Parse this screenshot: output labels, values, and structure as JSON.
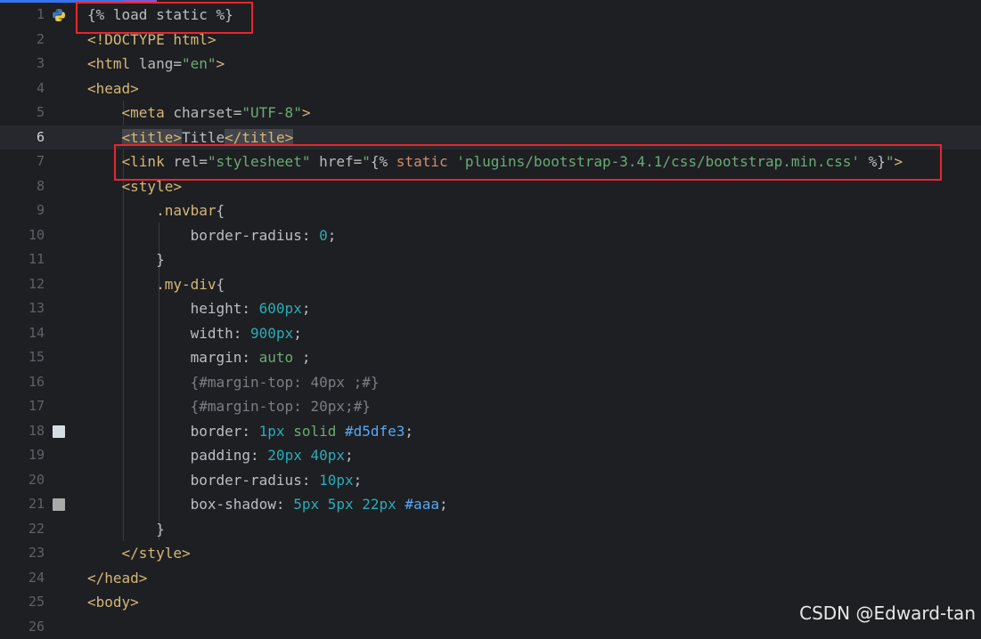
{
  "editor": {
    "lines": [
      {
        "n": "1",
        "segs": [
          [
            "tmpl",
            "{% load static %}"
          ]
        ]
      },
      {
        "n": "2",
        "segs": [
          [
            "tag",
            "<!DOCTYPE html>"
          ]
        ]
      },
      {
        "n": "3",
        "segs": [
          [
            "tag",
            "<html "
          ],
          [
            "attr",
            "lang="
          ],
          [
            "str",
            "\"en\""
          ],
          [
            "tag",
            ">"
          ]
        ]
      },
      {
        "n": "4",
        "segs": [
          [
            "tag",
            "<head>"
          ]
        ]
      },
      {
        "n": "5",
        "segs": [
          [
            "txt",
            "    "
          ],
          [
            "tag",
            "<meta "
          ],
          [
            "attr",
            "charset="
          ],
          [
            "str",
            "\"UTF-8\""
          ],
          [
            "tag",
            ">"
          ]
        ]
      },
      {
        "n": "6",
        "segs": [
          [
            "txt",
            "    "
          ],
          [
            "tag",
            "<title>"
          ],
          [
            "txt",
            "Title"
          ],
          [
            "tag",
            "</title>"
          ]
        ]
      },
      {
        "n": "7",
        "segs": [
          [
            "txt",
            "    "
          ],
          [
            "tag",
            "<link "
          ],
          [
            "attr",
            "rel="
          ],
          [
            "str",
            "\"stylesheet\""
          ],
          [
            "attr",
            " href="
          ],
          [
            "str",
            "\""
          ],
          [
            "tmpl",
            "{% "
          ],
          [
            "kw",
            "static "
          ],
          [
            "str",
            "'plugins/bootstrap-3.4.1/css/bootstrap.min.css'"
          ],
          [
            "tmpl",
            " %}"
          ],
          [
            "str",
            "\""
          ],
          [
            "tag",
            ">"
          ]
        ]
      },
      {
        "n": "8",
        "segs": [
          [
            "txt",
            "    "
          ],
          [
            "tag",
            "<style>"
          ]
        ]
      },
      {
        "n": "9",
        "segs": [
          [
            "txt",
            "        "
          ],
          [
            "cls",
            ".navbar"
          ],
          [
            "txt",
            "{"
          ]
        ]
      },
      {
        "n": "10",
        "segs": [
          [
            "txt",
            "            "
          ],
          [
            "txt",
            "border-radius: "
          ],
          [
            "num",
            "0"
          ],
          [
            "txt",
            ";"
          ]
        ]
      },
      {
        "n": "11",
        "segs": [
          [
            "txt",
            "        }"
          ]
        ]
      },
      {
        "n": "12",
        "segs": [
          [
            "txt",
            "        "
          ],
          [
            "cls",
            ".my-div"
          ],
          [
            "txt",
            "{"
          ]
        ]
      },
      {
        "n": "13",
        "segs": [
          [
            "txt",
            "            height: "
          ],
          [
            "num",
            "600px"
          ],
          [
            "txt",
            ";"
          ]
        ]
      },
      {
        "n": "14",
        "segs": [
          [
            "txt",
            "            width: "
          ],
          [
            "num",
            "900px"
          ],
          [
            "txt",
            ";"
          ]
        ]
      },
      {
        "n": "15",
        "segs": [
          [
            "txt",
            "            margin: "
          ],
          [
            "str",
            "auto"
          ],
          [
            "txt",
            " ;"
          ]
        ]
      },
      {
        "n": "16",
        "segs": [
          [
            "txt",
            "            "
          ],
          [
            "cm",
            "{#margin-top: 40px ;#}"
          ]
        ]
      },
      {
        "n": "17",
        "segs": [
          [
            "txt",
            "            "
          ],
          [
            "cm",
            "{#margin-top: 20px;#}"
          ]
        ]
      },
      {
        "n": "18",
        "segs": [
          [
            "txt",
            "            border: "
          ],
          [
            "num",
            "1px "
          ],
          [
            "str",
            "solid "
          ],
          [
            "hex",
            "#d5dfe3"
          ],
          [
            "txt",
            ";"
          ]
        ]
      },
      {
        "n": "19",
        "segs": [
          [
            "txt",
            "            padding: "
          ],
          [
            "num",
            "20px 40px"
          ],
          [
            "txt",
            ";"
          ]
        ]
      },
      {
        "n": "20",
        "segs": [
          [
            "txt",
            "            border-radius: "
          ],
          [
            "num",
            "10px"
          ],
          [
            "txt",
            ";"
          ]
        ]
      },
      {
        "n": "21",
        "segs": [
          [
            "txt",
            "            box-shadow: "
          ],
          [
            "num",
            "5px 5px 22px "
          ],
          [
            "hex",
            "#aaa"
          ],
          [
            "txt",
            ";"
          ]
        ]
      },
      {
        "n": "22",
        "segs": [
          [
            "txt",
            "        }"
          ]
        ]
      },
      {
        "n": "23",
        "segs": [
          [
            "txt",
            "    "
          ],
          [
            "tag",
            "</style>"
          ]
        ]
      },
      {
        "n": "24",
        "segs": [
          [
            "tag",
            "</head>"
          ]
        ]
      },
      {
        "n": "25",
        "segs": [
          [
            "tag",
            "<body>"
          ]
        ]
      },
      {
        "n": "26",
        "segs": []
      }
    ],
    "current_line": "6",
    "swatches": {
      "18": "#d5dfe3",
      "21": "#aaaaaa"
    }
  },
  "watermark": "CSDN @Edward-tan",
  "colors": {
    "highlight_box": "#e8262d",
    "background": "#1e1f22"
  }
}
